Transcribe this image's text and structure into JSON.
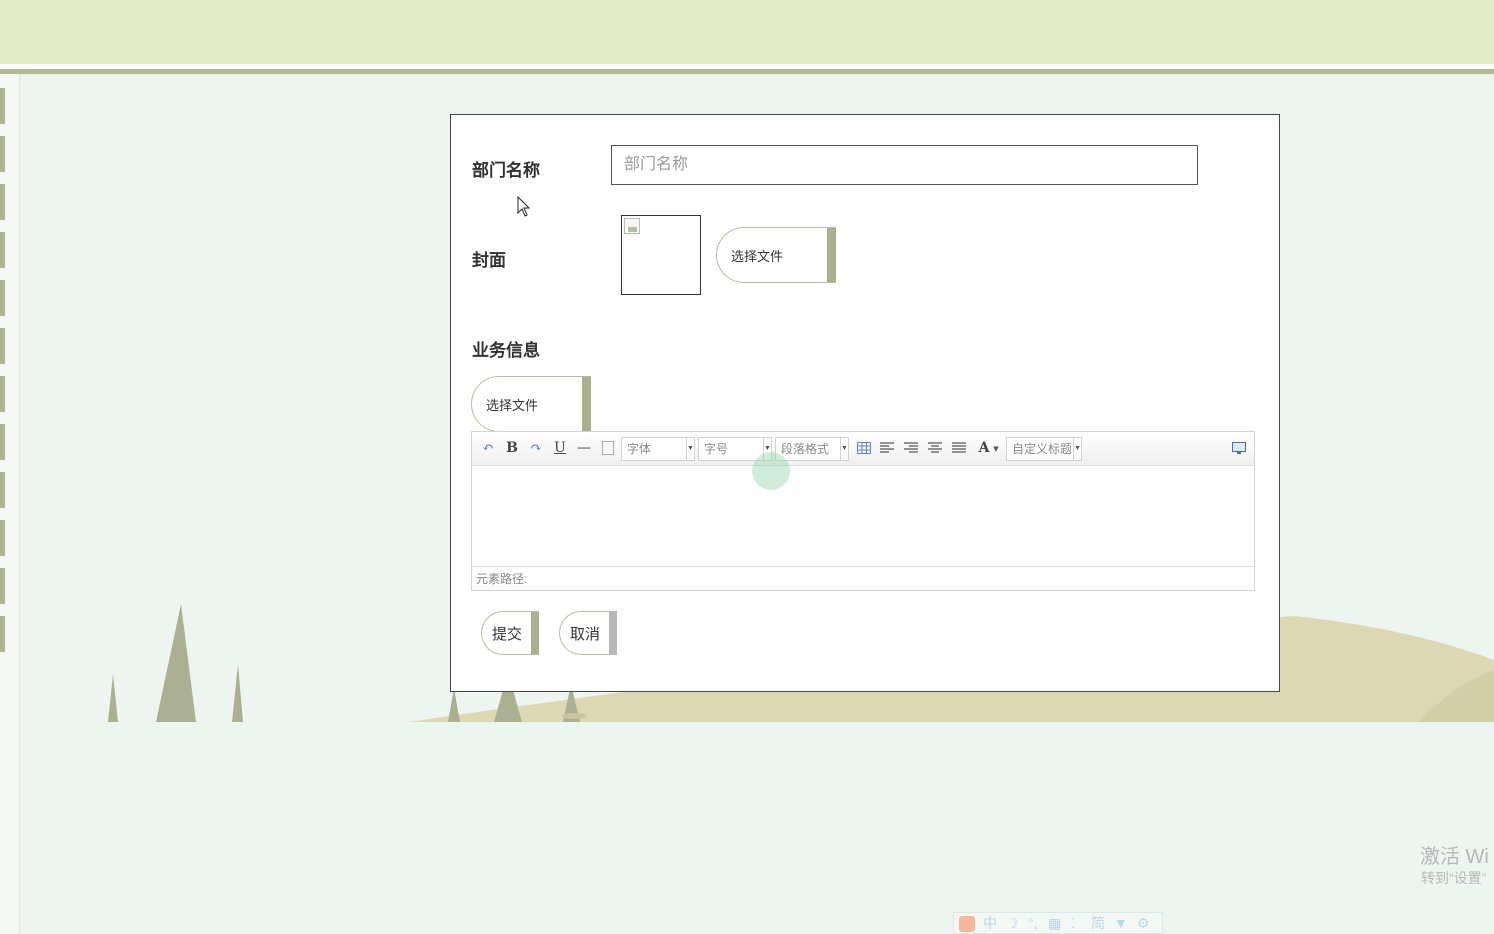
{
  "form": {
    "dept_name_label": "部门名称",
    "dept_name_placeholder": "部门名称",
    "dept_name_value": "",
    "cover_label": "封面",
    "cover_choose_file": "选择文件",
    "business_info_label": "业务信息",
    "business_choose_file": "选择文件",
    "submit": "提交",
    "cancel": "取消"
  },
  "editor": {
    "font_family": "字体",
    "font_size": "字号",
    "paragraph_format": "段落格式",
    "custom_title": "自定义标题",
    "element_path": "元素路径:",
    "icons": [
      "undo-icon",
      "bold-icon",
      "redo-icon",
      "underline-icon",
      "horizontal-rule-icon",
      "page-icon",
      "table-icon",
      "align-left-icon",
      "align-right-icon",
      "align-center-icon",
      "justify-icon",
      "font-color-icon",
      "preview-icon"
    ]
  },
  "windows_activation": {
    "title": "激活 Wi",
    "subtitle": "转到“设置”"
  },
  "ime_toolbar": {
    "mode": "中",
    "script": "简",
    "icons": [
      "sogou-logo-icon",
      "moon-icon",
      "punctuation-icon",
      "keyboard-icon",
      "mic-icon",
      "shirt-icon",
      "gear-icon"
    ]
  },
  "colors": {
    "header": "#e0eac4",
    "accent": "#aab08f",
    "background": "#eef5f0",
    "ground": "#dcd8b3",
    "tree": "#acb092"
  }
}
